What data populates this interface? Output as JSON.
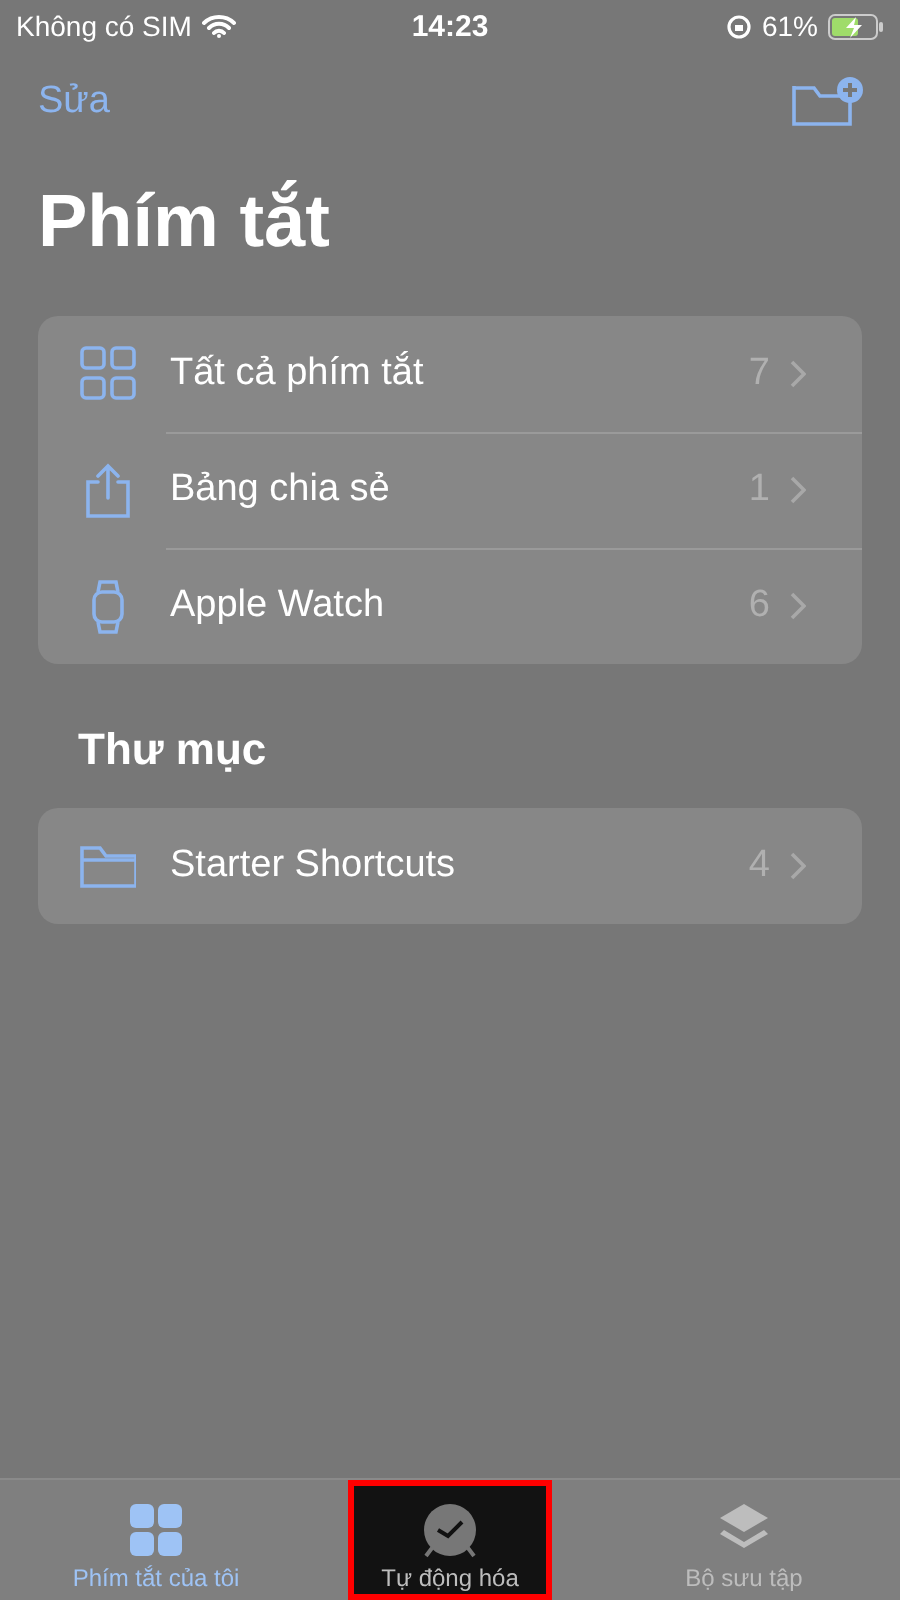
{
  "status_bar": {
    "carrier": "Không có SIM",
    "time": "14:23",
    "battery": "61%"
  },
  "nav": {
    "edit": "Sửa"
  },
  "title": "Phím tắt",
  "groups": [
    {
      "items": [
        {
          "kind": "grid",
          "label": "Tất cả phím tắt",
          "count": "7"
        },
        {
          "kind": "share",
          "label": "Bảng chia sẻ",
          "count": "1"
        },
        {
          "kind": "watch",
          "label": "Apple Watch",
          "count": "6"
        }
      ]
    },
    {
      "heading": "Thư mục",
      "items": [
        {
          "kind": "folder",
          "label": "Starter Shortcuts",
          "count": "4"
        }
      ]
    }
  ],
  "tabs": [
    {
      "kind": "grid",
      "label": "Phím tắt của tôi",
      "selected": true,
      "highlighted": false
    },
    {
      "kind": "clock",
      "label": "Tự động hóa",
      "selected": false,
      "highlighted": true
    },
    {
      "kind": "layers",
      "label": "Bộ sưu tập",
      "selected": false,
      "highlighted": false
    }
  ]
}
